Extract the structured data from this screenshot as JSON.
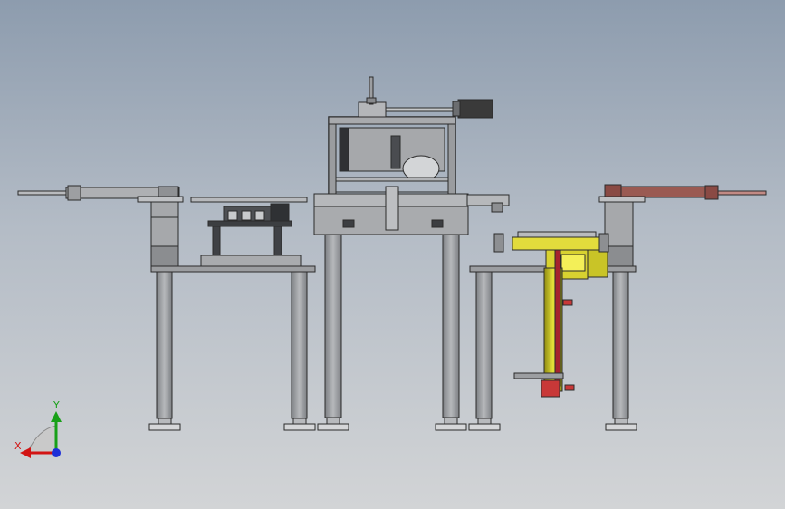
{
  "triad": {
    "x_label": "X",
    "y_label": "Y",
    "x_color": "#d21414",
    "y_color": "#18a018",
    "origin_color": "#1d2fd8"
  },
  "colors": {
    "frame": "#9a9c9f",
    "frame_dark": "#6f7276",
    "outline": "#2b2b2b",
    "motor": "#3a3a3a",
    "yellow_mechanism": "#d8d230",
    "red_parts": "#c83838",
    "brown_plate": "#9a5a52"
  }
}
